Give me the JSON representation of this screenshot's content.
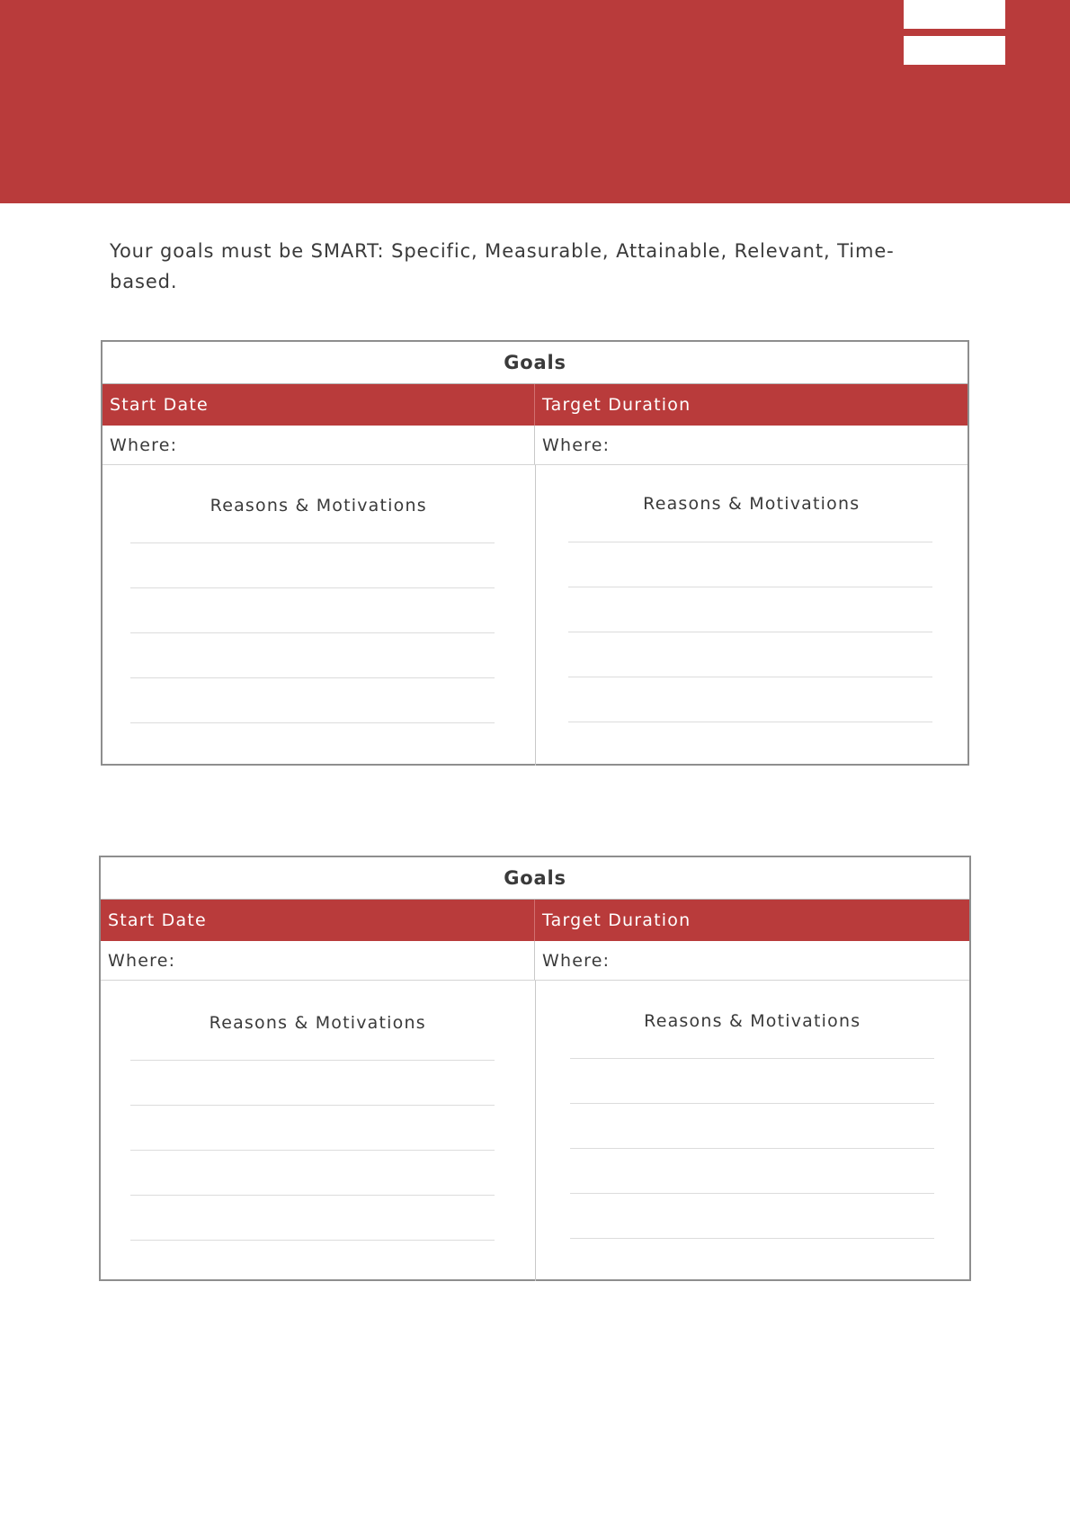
{
  "header": {
    "brand_color": "#b93b3b"
  },
  "intro": {
    "text": "Your goals must be SMART: Specific, Measurable, Attainable, Relevant, Time-based."
  },
  "goal_tables": [
    {
      "title": "Goals",
      "left_header": "Start Date",
      "right_header": "Target Duration",
      "left_where": "Where:",
      "right_where": "Where:",
      "left_section": "Reasons & Motivations",
      "right_section": "Reasons & Motivations",
      "blank_lines_per_column": 5
    },
    {
      "title": "Goals",
      "left_header": "Start Date",
      "right_header": "Target Duration",
      "left_where": "Where:",
      "right_where": "Where:",
      "left_section": "Reasons & Motivations",
      "right_section": "Reasons & Motivations",
      "blank_lines_per_column": 5
    }
  ]
}
